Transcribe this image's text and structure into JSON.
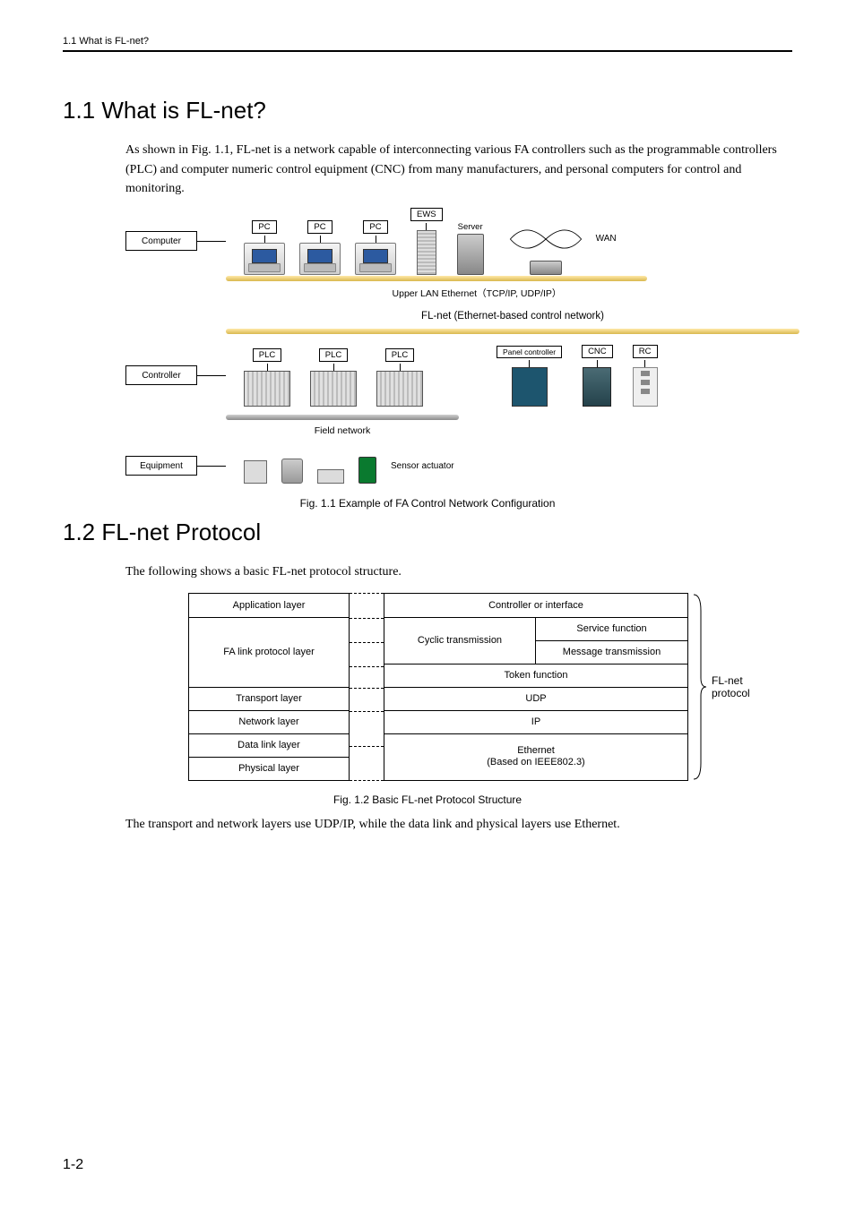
{
  "header": "1.1  What is FL-net?",
  "section1": {
    "title": "1.1  What is FL-net?",
    "para": "As shown in Fig. 1.1, FL-net is a network capable of interconnecting various FA controllers such as the programmable controllers (PLC) and computer numeric control equipment (CNC) from many manufacturers, and personal computers for control and monitoring."
  },
  "fig11": {
    "side": {
      "computer": "Computer",
      "controller": "Controller",
      "equipment": "Equipment"
    },
    "top_devices": {
      "pc": "PC",
      "ews": "EWS",
      "server": "Server",
      "wan": "WAN"
    },
    "upper_lan": "Upper LAN Ethernet（TCP/IP, UDP/IP）",
    "flnet_label": "FL-net (Ethernet-based control network)",
    "controllers": {
      "plc": "PLC",
      "panel": "Panel controller",
      "cnc": "CNC",
      "rc": "RC"
    },
    "field_network": "Field network",
    "sensor": "Sensor actuator",
    "caption": "Fig. 1.1  Example of FA Control Network Configuration"
  },
  "section2": {
    "title": "1.2  FL-net Protocol",
    "para1": "The following shows a basic FL-net protocol structure.",
    "para2": "The transport and network layers use UDP/IP, while the data link and physical layers use Ethernet."
  },
  "fig12": {
    "left": {
      "app": "Application layer",
      "falink": "FA link protocol layer",
      "transport": "Transport layer",
      "network": "Network layer",
      "datalink": "Data link layer",
      "physical": "Physical layer"
    },
    "right": {
      "controller": "Controller or interface",
      "cyclic": "Cyclic transmission",
      "service": "Service function",
      "message": "Message transmission",
      "token": "Token function",
      "udp": "UDP",
      "ip": "IP",
      "eth1": "Ethernet",
      "eth2": "(Based on IEEE802.3)"
    },
    "brace": "FL-net protocol",
    "caption": "Fig. 1.2  Basic FL-net Protocol Structure"
  },
  "page_num": "1-2"
}
